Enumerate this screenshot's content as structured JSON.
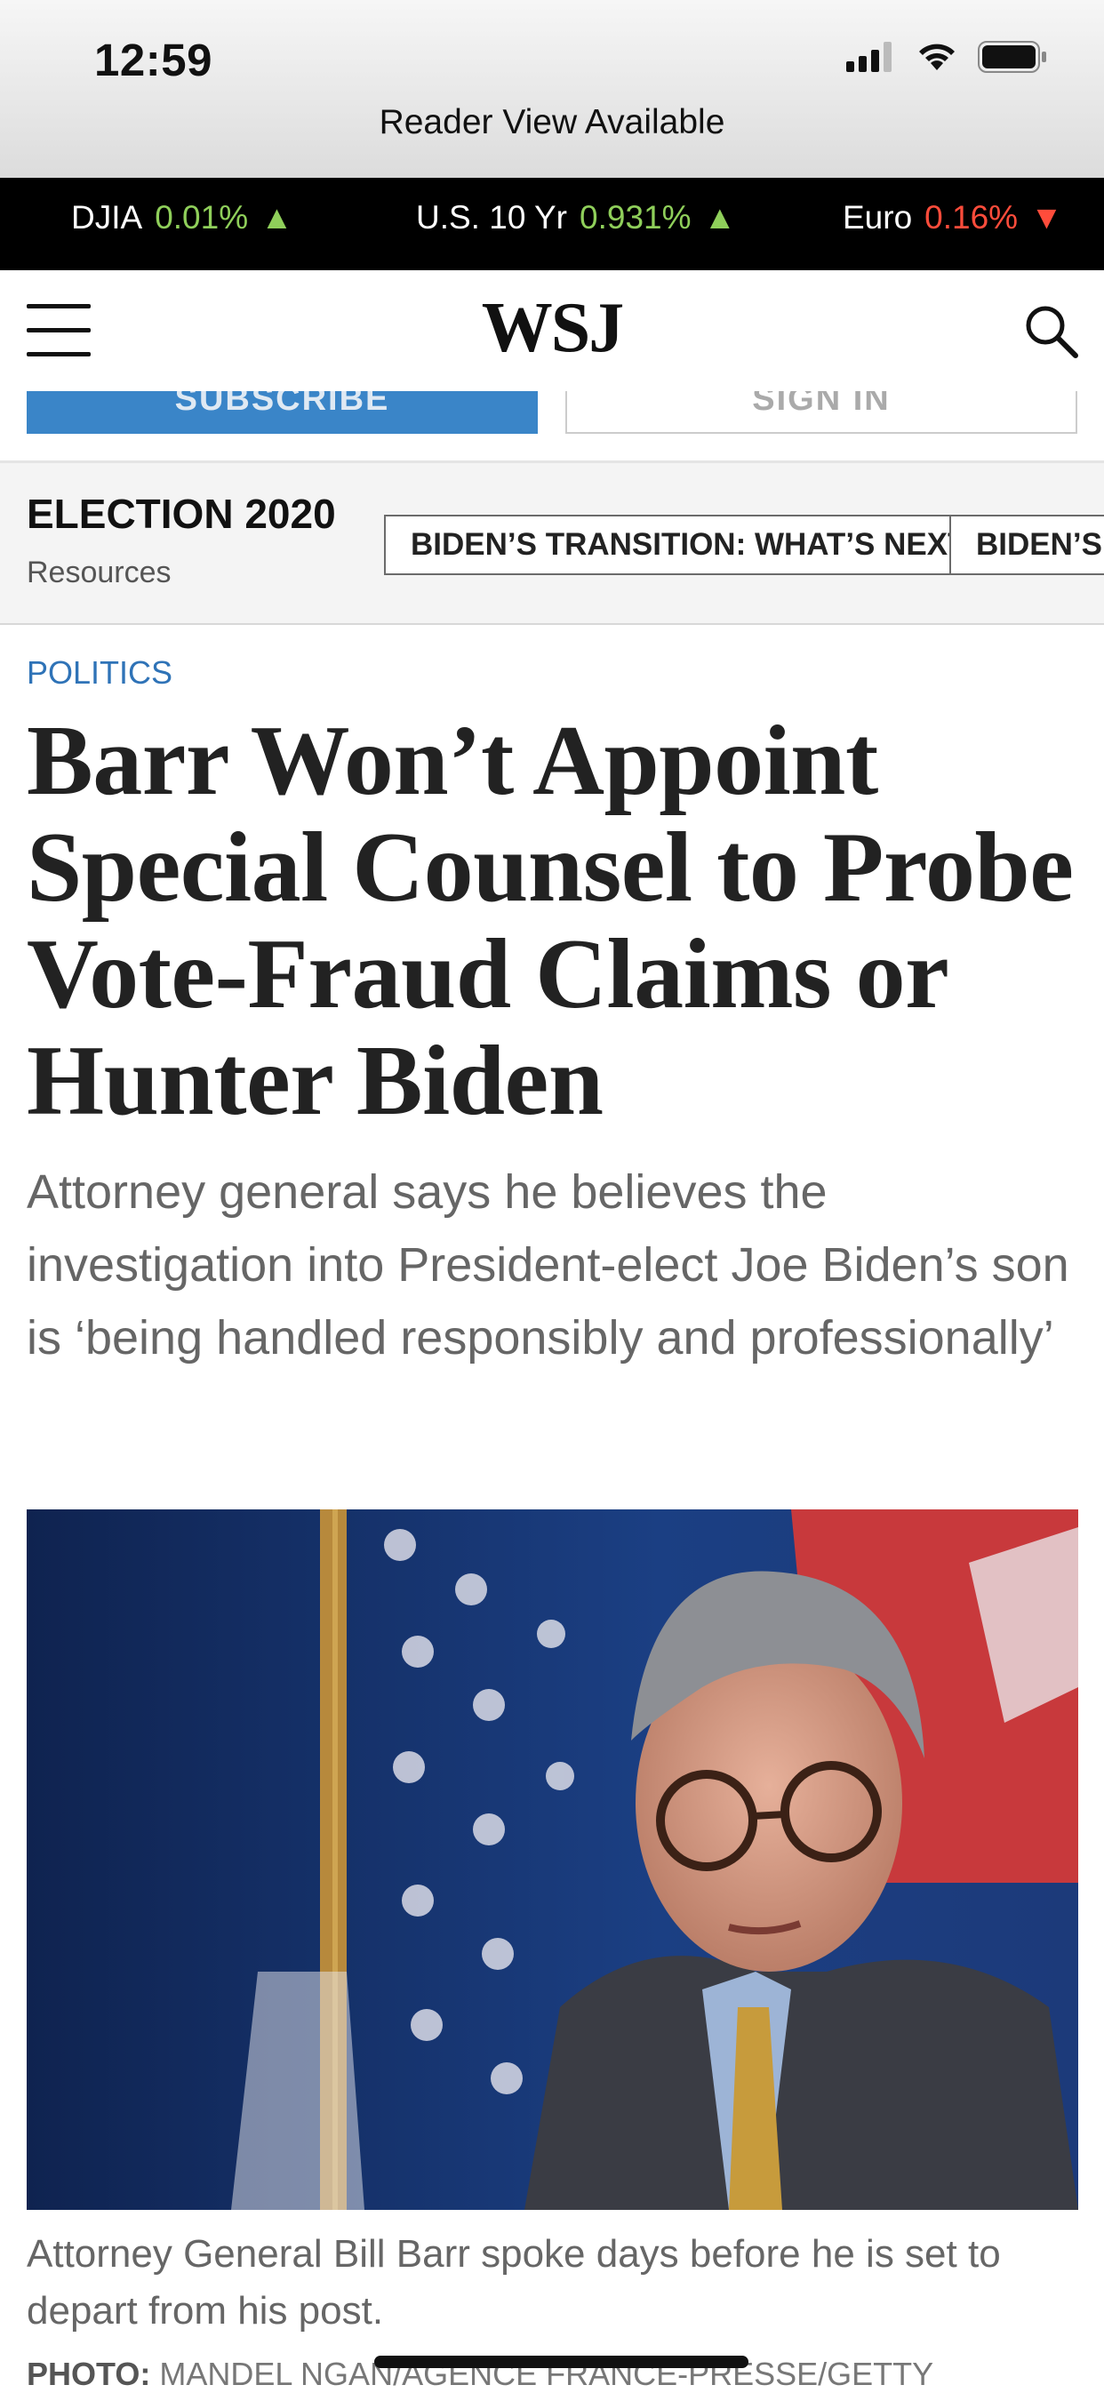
{
  "status_bar": {
    "time": "12:59"
  },
  "reader_banner": "Reader View Available",
  "ticker": [
    {
      "name": "DJIA",
      "value": "0.01%",
      "direction": "up"
    },
    {
      "name": "U.S. 10 Yr",
      "value": "0.931%",
      "direction": "up"
    },
    {
      "name": "Euro",
      "value": "0.16%",
      "direction": "down"
    }
  ],
  "header": {
    "logo": "WSJ"
  },
  "subscribe_strip": {
    "subscribe_label": "SUBSCRIBE",
    "signin_label": "SIGN IN"
  },
  "election": {
    "title": "ELECTION 2020",
    "subtitle": "Resources",
    "chips": [
      "BIDEN’S TRANSITION: WHAT’S NEXT",
      "BIDEN’S A"
    ]
  },
  "article": {
    "section": "POLITICS",
    "headline": "Barr Won’t Appoint Special Counsel to Probe Vote-Fraud Claims or Hunter Biden",
    "dek": "Attorney general says he believes the investigation into President-elect Joe Biden’s son is ‘being handled responsibly and professionally’",
    "caption": "Attorney General Bill Barr spoke days before he is set to depart from his post.",
    "credit_label": "PHOTO:",
    "credit_text": "MANDEL NGAN/AGENCE FRANCE-PRESSE/GETTY"
  },
  "colors": {
    "ticker_up": "#8fcf5a",
    "ticker_down": "#ff4c3b",
    "section": "#2f73b7",
    "subscribe": "#3a85c8"
  }
}
